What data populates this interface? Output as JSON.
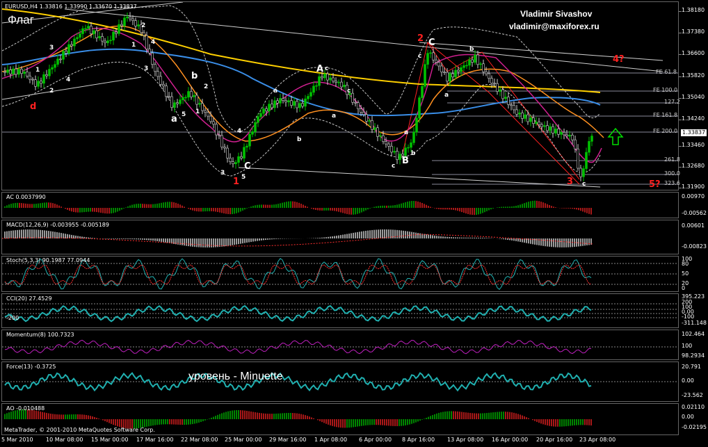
{
  "symbol_header": "EURUSD,H4  1.33816  1.33990  1.33670  1.33837",
  "watermark_title": "Флаг",
  "author": {
    "name": "Vladimir Sivashov",
    "email": "vladimir@maxiforex.ru"
  },
  "level_caption": "уровень - Minuette",
  "copyright": "MetaTrader, © 2001-2010 MetaQuotes Software Corp.",
  "colors": {
    "background": "#000000",
    "yellow_ma": "#ffd000",
    "blue_ma": "#3a8ee8",
    "orange_ma": "#ff9020",
    "magenta_ma": "#d02090",
    "bull_candle": "#00c000",
    "ind_line": "#20b0b0",
    "momentum": "#c020c0",
    "wave_red": "#ff2020"
  },
  "main_axis": {
    "ticks": [
      "1.38180",
      "1.37380",
      "1.36600",
      "1.35820",
      "1.35040",
      "1.34240",
      "1.33460",
      "1.32680",
      "1.31900"
    ],
    "current_price": "1.33837"
  },
  "fib_levels": [
    {
      "label": "FE 61.8"
    },
    {
      "label": "FE 100.0"
    },
    {
      "label": "127.2"
    },
    {
      "label": "FE 161.8"
    },
    {
      "label": "FE 200.0"
    },
    {
      "label": "261.8"
    },
    {
      "label": "300.0"
    },
    {
      "label": "323.6"
    }
  ],
  "wave_labels": {
    "major": [
      "1",
      "2",
      "3",
      "4?",
      "5?"
    ],
    "minor": [
      "A",
      "B",
      "C",
      "a",
      "b",
      "c",
      "d"
    ]
  },
  "panels": [
    {
      "title": "AC 0.0037990",
      "scale": [
        "0.00970",
        "-0.00562"
      ]
    },
    {
      "title": "MACD(12,26,9) -0.003955 -0.005189",
      "scale": [
        "0.00601",
        "-0.00823"
      ]
    },
    {
      "title": "Stoch(5,3,3) 90.1987 77.0944",
      "scale": [
        "100",
        "80",
        "50",
        "20",
        "0"
      ]
    },
    {
      "title": "CCI(20) 27.4529",
      "scale": [
        "395.223",
        "200",
        "100",
        "0.00",
        "-100",
        "-200",
        "-311.148"
      ],
      "inner_label": "-200"
    },
    {
      "title": "Momentum(8) 100.7323",
      "scale": [
        "102.464",
        "100",
        "98.2934"
      ]
    },
    {
      "title": "Force(13) -0.3725",
      "scale": [
        "20.791",
        "0.00",
        "-23.562"
      ]
    },
    {
      "title": "AO -0.010488",
      "scale": [
        "0.02110",
        "0.00",
        "-0.02195"
      ]
    }
  ],
  "time_axis": [
    "5 Mar 2010",
    "10 Mar 08:00",
    "15 Mar 00:00",
    "17 Mar 16:00",
    "22 Mar 08:00",
    "25 Mar 00:00",
    "29 Mar 16:00",
    "1 Apr 08:00",
    "6 Apr 00:00",
    "8 Apr 16:00",
    "13 Apr 08:00",
    "16 Apr 00:00",
    "20 Apr 16:00",
    "23 Apr 08:00"
  ]
}
